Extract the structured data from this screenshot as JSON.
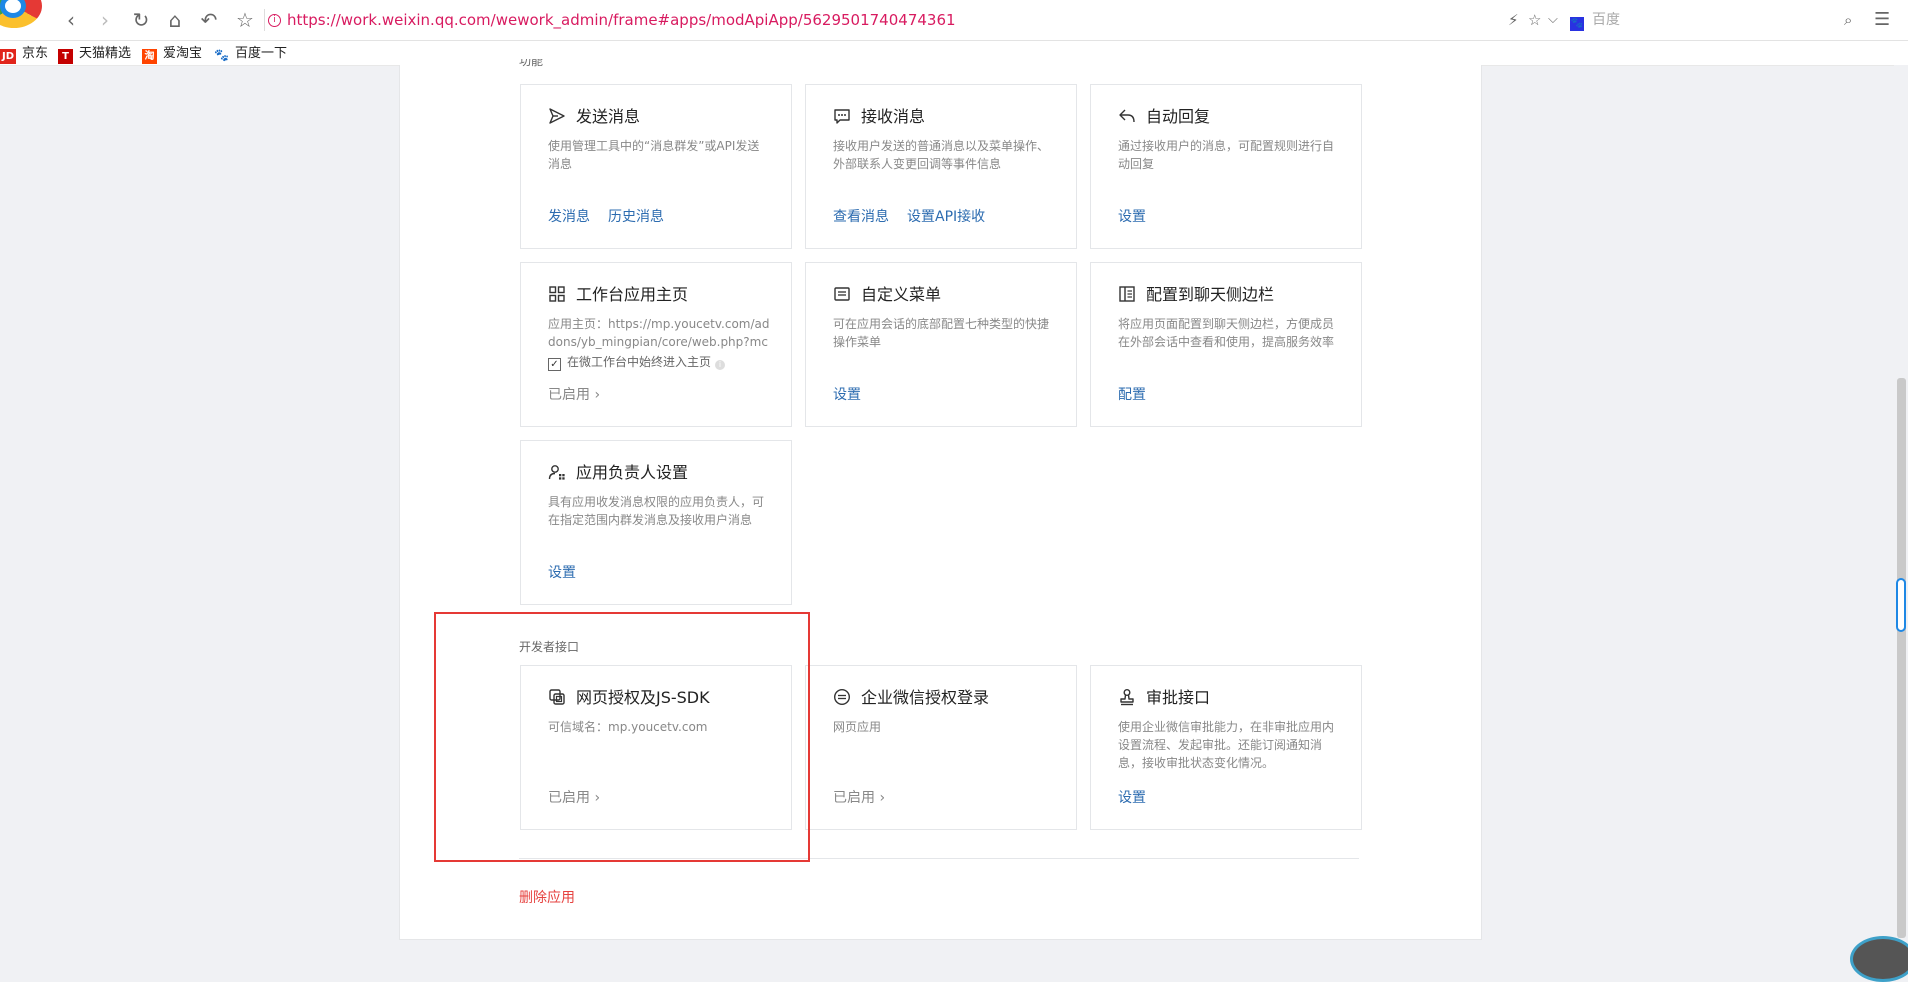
{
  "browser": {
    "url": "https://work.weixin.qq.com/wework_admin/frame#apps/modApiApp/5629501740474361",
    "search_placeholder": "百度",
    "bookmarks": [
      {
        "icon": "JD",
        "label": "京东",
        "color": "#e1251b"
      },
      {
        "icon": "T",
        "label": "天猫精选",
        "color": "#c40000"
      },
      {
        "icon": "淘",
        "label": "爱淘宝",
        "color": "#ff4400"
      },
      {
        "icon": "🐾",
        "label": "百度一下",
        "color": "#2932e1"
      }
    ]
  },
  "sections": {
    "cutoff_label": "功能",
    "dev_label": "开发者接口"
  },
  "cards": {
    "send": {
      "title": "发送消息",
      "desc": "使用管理工具中的“消息群发”或API发送消息",
      "link1": "发消息",
      "link2": "历史消息"
    },
    "receive": {
      "title": "接收消息",
      "desc": "接收用户发送的普通消息以及菜单操作、外部联系人变更回调等事件信息",
      "link1": "查看消息",
      "link2": "设置API接收"
    },
    "autoreply": {
      "title": "自动回复",
      "desc": "通过接收用户的消息，可配置规则进行自动回复",
      "link1": "设置"
    },
    "homepage": {
      "title": "工作台应用主页",
      "desc": "应用主页：https://mp.youcetv.com/addons/yb_mingpian/core/web.php?mch_id=...",
      "check": "在微工作台中始终进入主页",
      "status": "已启用"
    },
    "menu": {
      "title": "自定义菜单",
      "desc": "可在应用会话的底部配置七种类型的快捷操作菜单",
      "link1": "设置"
    },
    "sidebar": {
      "title": "配置到聊天侧边栏",
      "desc": "将应用页面配置到聊天侧边栏，方便成员在外部会话中查看和使用，提高服务效率",
      "link1": "配置"
    },
    "owner": {
      "title": "应用负责人设置",
      "desc": "具有应用收发消息权限的应用负责人，可在指定范围内群发消息及接收用户消息",
      "link1": "设置"
    },
    "jssdk": {
      "title": "网页授权及JS-SDK",
      "desc": "可信域名：mp.youcetv.com",
      "status": "已启用"
    },
    "wxlogin": {
      "title": "企业微信授权登录",
      "desc": "网页应用",
      "status": "已启用"
    },
    "approval": {
      "title": "审批接口",
      "desc": "使用企业微信审批能力，在非审批应用内设置流程、发起审批。还能订阅通知消息，接收审批状态变化情况。",
      "link1": "设置"
    }
  },
  "footer": {
    "delete_label": "删除应用"
  },
  "colors": {
    "link": "#2d6cb0",
    "danger": "#e64340",
    "highlight": "#e53935"
  }
}
